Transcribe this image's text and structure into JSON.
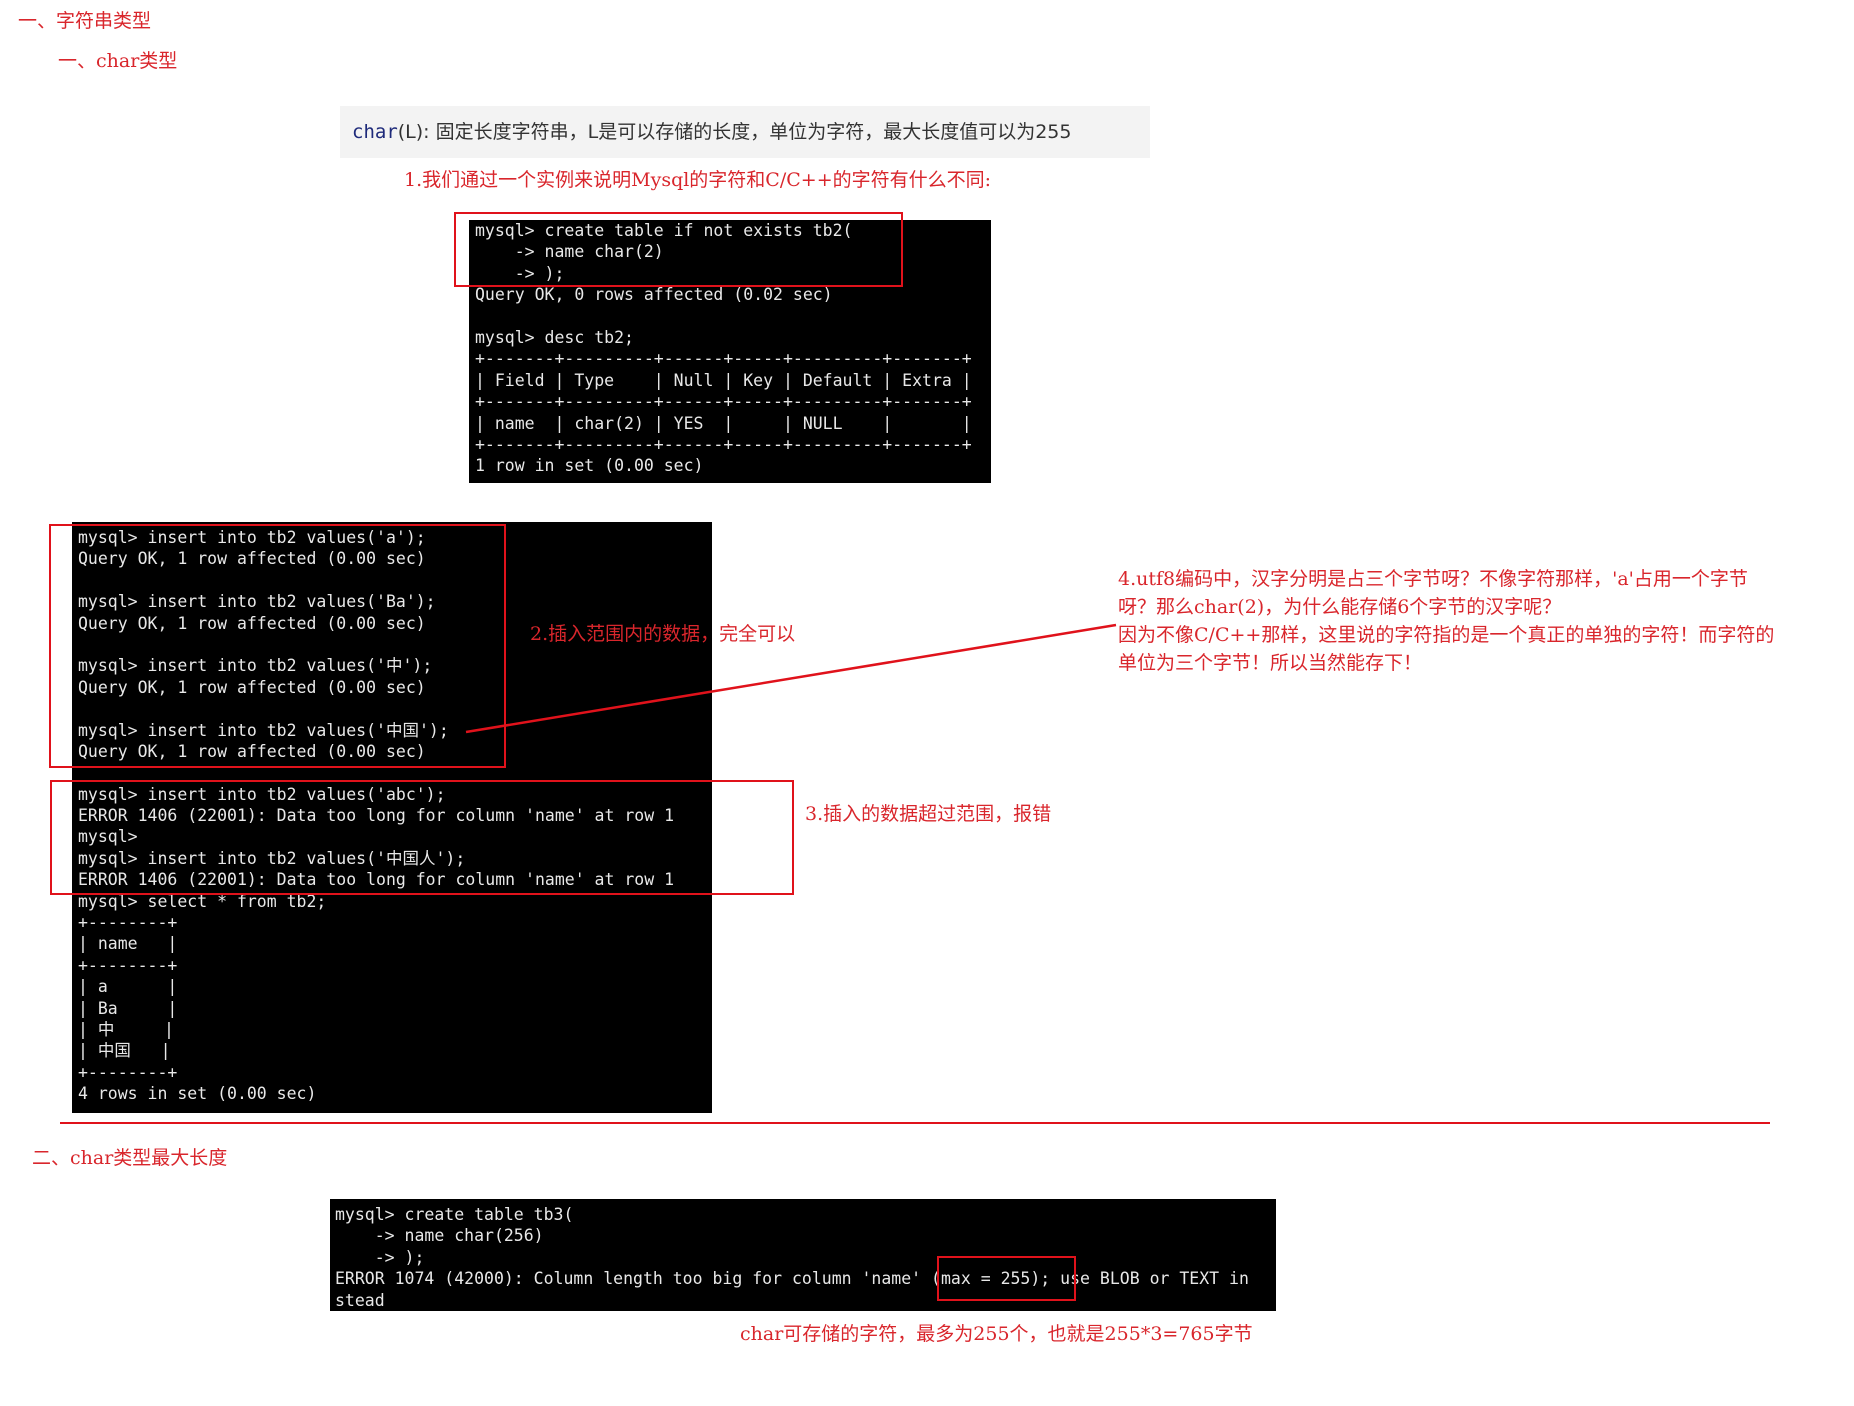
{
  "headings": {
    "h1": "一、字符串类型",
    "h2": "一、char类型",
    "h3": "二、char类型最大长度"
  },
  "quote": {
    "keyword": "char",
    "text": "(L): 固定长度字符串，L是可以存储的长度，单位为字符，最大长度值可以为255"
  },
  "notes": {
    "n1": "1.我们通过一个实例来说明Mysql的字符和C/C++的字符有什么不同:",
    "n2": "2.插入范围内的数据，完全可以",
    "n3": "3.插入的数据超过范围，报错",
    "n4": [
      "4.utf8编码中，汉字分明是占三个字节呀？不像字符那样，'a'占用一个字节",
      "呀？那么char(2)，为什么能存储6个字节的汉字呢？",
      "因为不像C/C++那样，这里说的字符指的是一个真正的单独的字符！而字符的",
      "单位为三个字节！所以当然能存下！"
    ],
    "n5": "char可存储的字符，最多为255个，也就是255*3=765字节"
  },
  "terminal1": [
    "mysql> create table if not exists tb2(",
    "    -> name char(2)",
    "    -> );",
    "Query OK, 0 rows affected (0.02 sec)",
    "",
    "mysql> desc tb2;",
    "+-------+---------+------+-----+---------+-------+",
    "| Field | Type    | Null | Key | Default | Extra |",
    "+-------+---------+------+-----+---------+-------+",
    "| name  | char(2) | YES  |     | NULL    |       |",
    "+-------+---------+------+-----+---------+-------+",
    "1 row in set (0.00 sec)"
  ],
  "terminal2": [
    "mysql> insert into tb2 values('a');",
    "Query OK, 1 row affected (0.00 sec)",
    "",
    "mysql> insert into tb2 values('Ba');",
    "Query OK, 1 row affected (0.00 sec)",
    "",
    "mysql> insert into tb2 values('中');",
    "Query OK, 1 row affected (0.00 sec)",
    "",
    "mysql> insert into tb2 values('中国');",
    "Query OK, 1 row affected (0.00 sec)",
    "",
    "mysql> insert into tb2 values('abc');",
    "ERROR 1406 (22001): Data too long for column 'name' at row 1",
    "mysql>",
    "mysql> insert into tb2 values('中国人');",
    "ERROR 1406 (22001): Data too long for column 'name' at row 1",
    "mysql> select * from tb2;",
    "+--------+",
    "| name   |",
    "+--------+",
    "| a      |",
    "| Ba     |",
    "| 中     |",
    "| 中国   |",
    "+--------+",
    "4 rows in set (0.00 sec)"
  ],
  "terminal3": [
    "mysql> create table tb3(",
    "    -> name char(256)",
    "    -> );",
    "ERROR 1074 (42000): Column length too big for column 'name' (max = 255); use BLOB or TEXT in",
    "stead"
  ],
  "colors": {
    "accent": "#d9262c",
    "box": "#e0121b",
    "terminal_bg": "#000000",
    "terminal_fg": "#e8e8e8"
  }
}
